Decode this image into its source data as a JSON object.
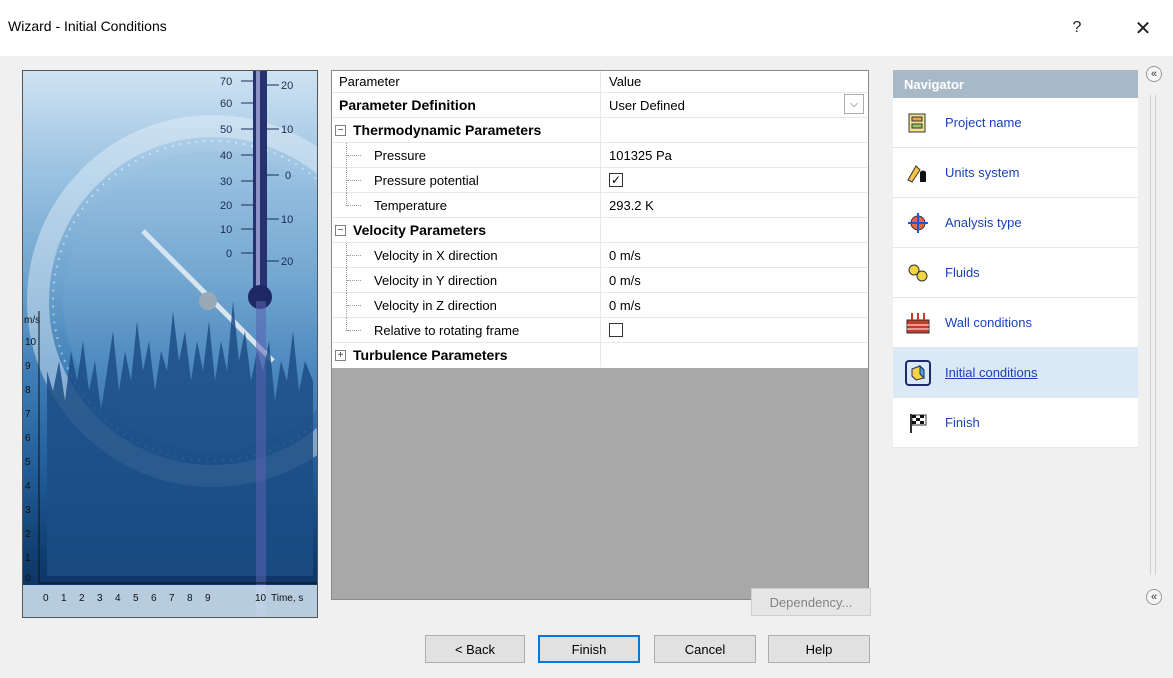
{
  "window": {
    "title": "Wizard - Initial Conditions",
    "help_glyph": "?",
    "close_glyph": "✕"
  },
  "image": {
    "thermometer_scale": [
      "70",
      "60",
      "50",
      "40",
      "30",
      "20",
      "10",
      "0"
    ],
    "thermometer_right_scale": [
      "20",
      "10",
      "0",
      "10",
      "20"
    ],
    "chart_y_unit": "m/s",
    "chart_y_ticks": [
      "10",
      "9",
      "8",
      "7",
      "6",
      "5",
      "4",
      "3",
      "2",
      "1",
      "0"
    ],
    "chart_x_ticks": [
      "0",
      "1",
      "2",
      "3",
      "4",
      "5",
      "6",
      "7",
      "8",
      "9",
      "10"
    ],
    "chart_x_unit": "Time, s"
  },
  "grid": {
    "col_param": "Parameter",
    "col_value": "Value",
    "param_definition_label": "Parameter Definition",
    "param_definition_value": "User Defined",
    "thermo_group": "Thermodynamic Parameters",
    "pressure_label": "Pressure",
    "pressure_value": "101325 Pa",
    "pressure_potential_label": "Pressure potential",
    "pressure_potential_checked": true,
    "temperature_label": "Temperature",
    "temperature_value": "293.2 K",
    "velocity_group": "Velocity Parameters",
    "vx_label": "Velocity in X direction",
    "vx_value": "0 m/s",
    "vy_label": "Velocity in Y direction",
    "vy_value": "0 m/s",
    "vz_label": "Velocity in Z direction",
    "vz_value": "0 m/s",
    "rotating_label": "Relative to rotating frame",
    "rotating_checked": false,
    "turbulence_group": "Turbulence Parameters"
  },
  "buttons": {
    "dependency": "Dependency...",
    "back": "< Back",
    "finish": "Finish",
    "cancel": "Cancel",
    "help": "Help"
  },
  "navigator": {
    "title": "Navigator",
    "items": [
      {
        "label": "Project name",
        "icon": "project-name-icon"
      },
      {
        "label": "Units system",
        "icon": "units-system-icon"
      },
      {
        "label": "Analysis type",
        "icon": "analysis-type-icon"
      },
      {
        "label": "Fluids",
        "icon": "fluids-icon"
      },
      {
        "label": "Wall conditions",
        "icon": "wall-conditions-icon"
      },
      {
        "label": "Initial conditions",
        "icon": "initial-conditions-icon",
        "active": true
      },
      {
        "label": "Finish",
        "icon": "finish-flag-icon"
      }
    ],
    "collapse_glyph": "«"
  },
  "colors": {
    "navigator_header": "#a7b8c6",
    "nav_link": "#1a3fbd",
    "active_item_bg": "#dbe8f5",
    "grid_empty_area": "#a8a8a8"
  }
}
